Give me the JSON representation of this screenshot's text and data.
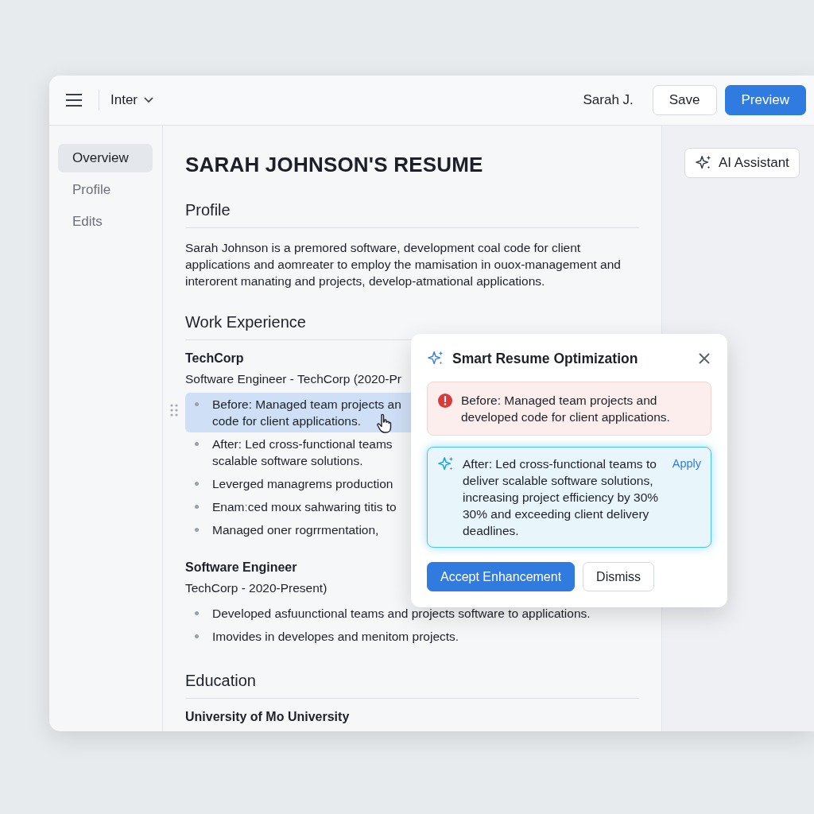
{
  "toolbar": {
    "font": "Inter",
    "user": "Sarah J.",
    "buttons": [
      {
        "label": "Save",
        "kind": "secondary"
      },
      {
        "label": "Preview",
        "kind": "primary"
      }
    ]
  },
  "sidebar": {
    "items": [
      {
        "label": "Overview",
        "selected": true
      },
      {
        "label": "Profile",
        "selected": false
      },
      {
        "label": "Edits",
        "selected": false
      }
    ]
  },
  "document": {
    "title": "SARAH JOHNSON'S RESUME",
    "sections": [
      {
        "heading": "Profile",
        "paragraph": "Sarah Johnson is a premored software, development coal code for client applications and aomreater to employ the mamisation in ouox-management and interorent manating and projects, develop-atmational applications."
      },
      {
        "heading": "Work Experience",
        "jobs": [
          {
            "company": "TechCorp",
            "role": "Software Engineer - TechCorp (2020-Pr",
            "bullets": [
              {
                "lines": [
                  "Before: Managed team projects an",
                  "code for client applications."
                ],
                "selected": true
              },
              {
                "lines": [
                  "After: Led cross-functional teams",
                  "scalable software solutions."
                ],
                "selected": false
              },
              {
                "lines": [
                  "Leverged managrems production"
                ],
                "selected": false
              },
              {
                "lines": [
                  "Enamːced moux sahwaring titis to"
                ],
                "selected": false
              },
              {
                "lines": [
                  "Managed oner rogrrmentation,"
                ],
                "selected": false
              }
            ]
          },
          {
            "company": "Software Engineer",
            "role": "TechCorp - 2020-Present)",
            "bullets": [
              {
                "lines": [
                  "Developed asfuunctional teams  and projects software to applications."
                ],
                "selected": false
              },
              {
                "lines": [
                  "Imovides in developes and menitom projects."
                ],
                "selected": false
              }
            ]
          }
        ]
      },
      {
        "heading": "Education",
        "jobs": [
          {
            "company": "University of Mo University"
          }
        ]
      }
    ]
  },
  "assistant": {
    "button": "AI Assistant"
  },
  "popover": {
    "title": "Smart Resume Optimization",
    "before": "Before: Managed team projects and developed code for client applications.",
    "after": "After: Led cross-functional teams to deliver scalable software solutions, increasing project efficiency by 30% 30% and exceeding client delivery deadlines.",
    "apply": "Apply",
    "buttons": [
      {
        "label": "Accept Enhancement",
        "kind": "primary"
      },
      {
        "label": "Dismiss",
        "kind": "secondary"
      }
    ]
  }
}
